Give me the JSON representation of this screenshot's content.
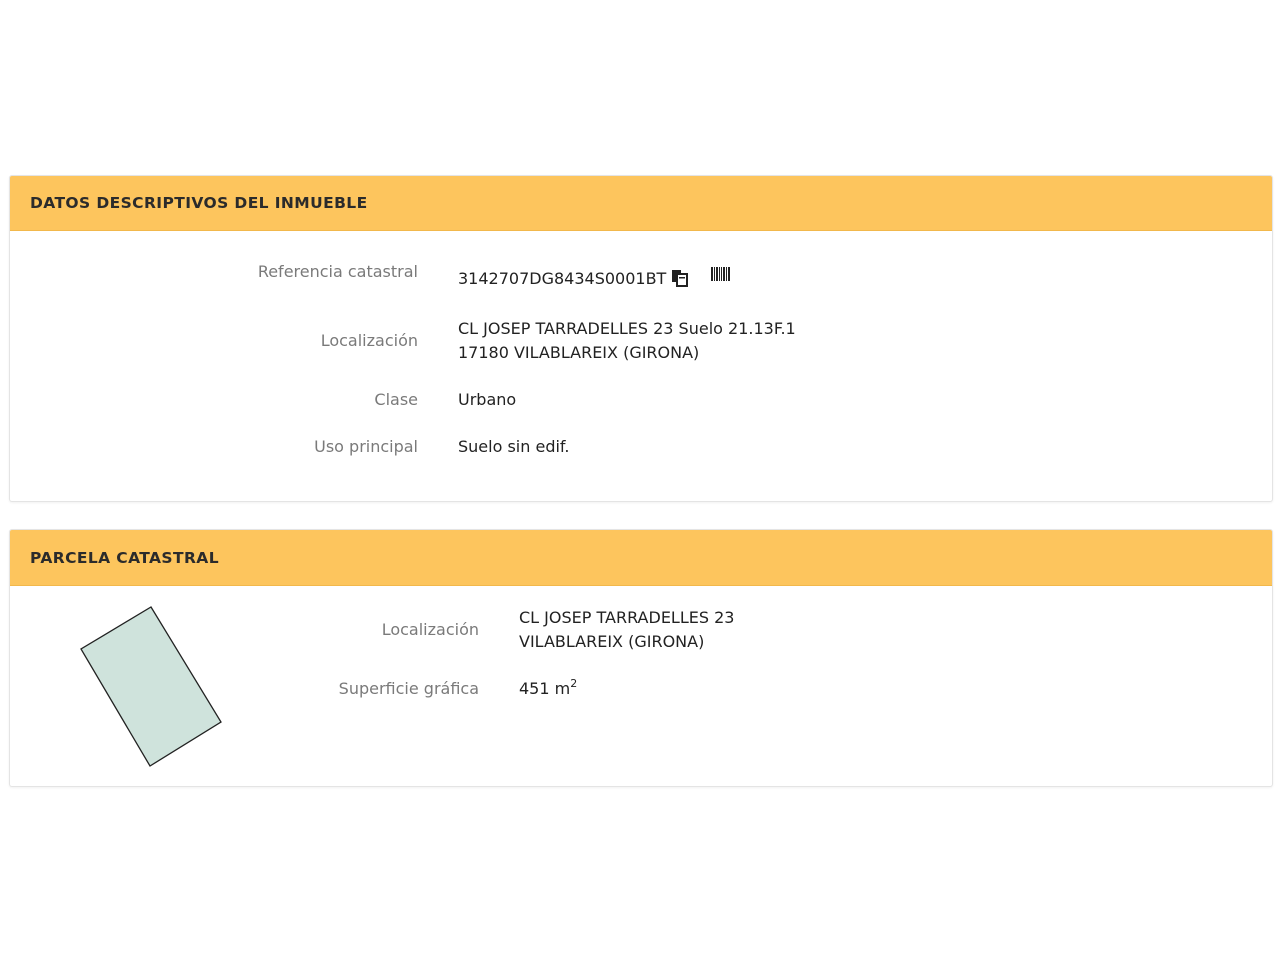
{
  "inmueble": {
    "title": "DATOS DESCRIPTIVOS DEL INMUEBLE",
    "rows": {
      "referencia": {
        "label": "Referencia catastral",
        "value": "3142707DG8434S0001BT"
      },
      "localizacion": {
        "label": "Localización",
        "line1": "CL JOSEP TARRADELLES 23 Suelo 21.13F.1",
        "line2": "17180 VILABLAREIX (GIRONA)"
      },
      "clase": {
        "label": "Clase",
        "value": "Urbano"
      },
      "uso": {
        "label": "Uso principal",
        "value": "Suelo sin edif."
      }
    },
    "icons": [
      "copy-icon",
      "barcode-icon"
    ]
  },
  "parcela": {
    "title": "PARCELA CATASTRAL",
    "rows": {
      "localizacion": {
        "label": "Localización",
        "line1": "CL JOSEP TARRADELLES 23",
        "line2": "VILABLAREIX (GIRONA)"
      },
      "superficie": {
        "label": "Superficie gráfica",
        "value": "451 m",
        "unit_exp": "2"
      }
    },
    "map_fill": "#cfe3dc"
  },
  "colors": {
    "header": "#fdc55d",
    "label": "#7a7a7a",
    "value": "#222222"
  }
}
